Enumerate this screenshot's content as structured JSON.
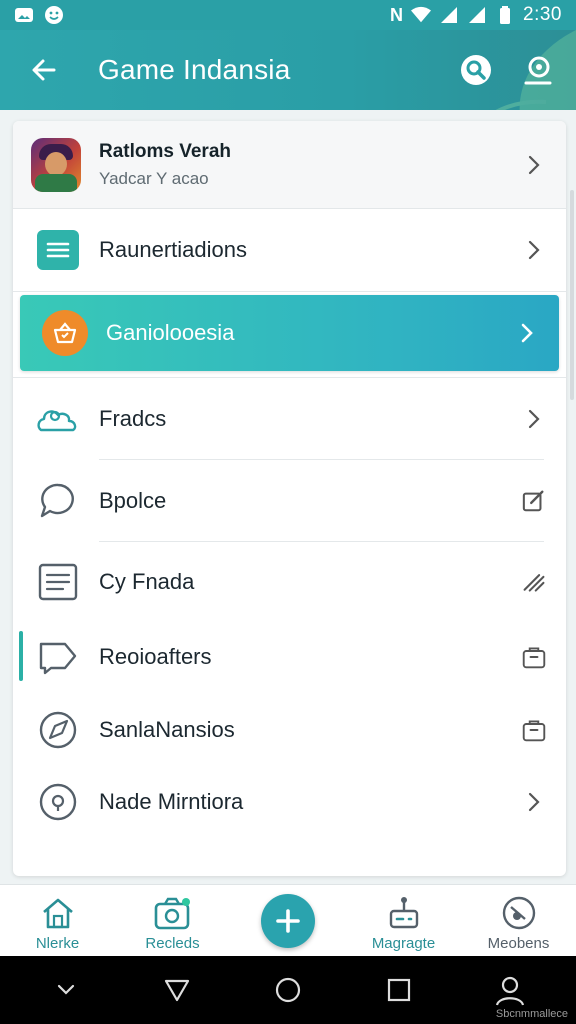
{
  "status_bar": {
    "time": "2:30",
    "nfc_label": "N"
  },
  "app_bar": {
    "title": "Game Indansia"
  },
  "profile": {
    "name": "Ratloms Verah",
    "subtitle": "Yadcar Y acao"
  },
  "menu": {
    "items": [
      {
        "label": "Raunertiadions",
        "icon": "list-icon",
        "trailing": "chevron-right-icon"
      },
      {
        "label": "Ganiolooesia",
        "icon": "basket-icon",
        "trailing": "chevron-right-icon",
        "active": true
      },
      {
        "label": "Fradcs",
        "icon": "people-icon",
        "trailing": "chevron-right-icon"
      },
      {
        "label": "Bpolce",
        "icon": "chat-bubble-icon",
        "trailing": "edit-icon"
      },
      {
        "label": "Cy Fnada",
        "icon": "document-icon",
        "trailing": "pencil-lines-icon"
      },
      {
        "label": "Reoioafters",
        "icon": "tag-icon",
        "trailing": "bag-icon"
      },
      {
        "label": "SanlaNansios",
        "icon": "compass-icon",
        "trailing": "bag-icon"
      },
      {
        "label": "Nade Mirntiora",
        "icon": "info-icon",
        "trailing": "chevron-right-icon"
      }
    ]
  },
  "bottom_nav": {
    "items": [
      {
        "label": "Nlerke",
        "icon": "home-icon",
        "color": "#2a8f96"
      },
      {
        "label": "Recleds",
        "icon": "camera-icon",
        "color": "#2a8f96"
      },
      {
        "label": "Magragte",
        "icon": "joystick-icon",
        "color": "#2a8f96"
      },
      {
        "label": "Meobens",
        "icon": "slash-circle-icon",
        "color": "#55606a"
      }
    ],
    "fab_icon": "plus-icon"
  },
  "system_nav": {
    "watermark": "Sbcnmmallece"
  },
  "colors": {
    "primary": "#2aa0a6",
    "active_row": "#35bdbd",
    "active_badge": "#ef8b2a"
  }
}
